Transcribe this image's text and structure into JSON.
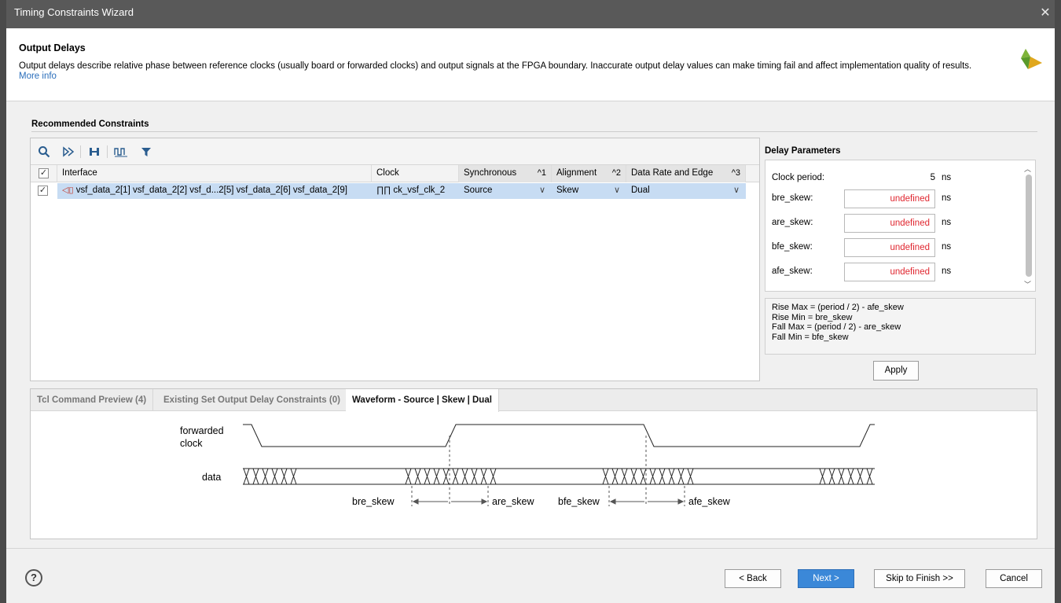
{
  "window": {
    "title": "Timing Constraints Wizard",
    "close_glyph": "✕"
  },
  "header": {
    "title": "Output Delays",
    "description": "Output delays describe relative phase between reference clocks (usually board or forwarded clocks) and output signals at the FPGA boundary. Inaccurate output delay values can make timing fail and affect implementation quality of results.",
    "more_info": "More info",
    "logo_icon": "vivado-logo-icon"
  },
  "recommended": {
    "label": "Recommended Constraints",
    "toolbar_icons": [
      "search-icon",
      "select-icon",
      "expand-icon",
      "clock-icon",
      "filter-icon"
    ],
    "columns": [
      {
        "label": "Interface",
        "sort": ""
      },
      {
        "label": "Clock",
        "sort": ""
      },
      {
        "label": "Synchronous",
        "sort": "^1"
      },
      {
        "label": "Alignment",
        "sort": "^2"
      },
      {
        "label": "Data Rate and Edge",
        "sort": "^3"
      }
    ],
    "rows": [
      {
        "checked": true,
        "interface": "vsf_data_2[1] vsf_data_2[2] vsf_d...2[5] vsf_data_2[6] vsf_data_2[9]",
        "clock": "ck_vsf_clk_2",
        "synchronous": "Source",
        "alignment": "Skew",
        "data_rate": "Dual"
      }
    ]
  },
  "delay_parameters": {
    "label": "Delay Parameters",
    "clock_period": {
      "label": "Clock period:",
      "value": "5",
      "unit": "ns"
    },
    "params": [
      {
        "label": "bre_skew:",
        "value": "undefined",
        "unit": "ns"
      },
      {
        "label": "are_skew:",
        "value": "undefined",
        "unit": "ns"
      },
      {
        "label": "bfe_skew:",
        "value": "undefined",
        "unit": "ns"
      },
      {
        "label": "afe_skew:",
        "value": "undefined",
        "unit": "ns"
      }
    ],
    "formulas": [
      "Rise Max = (period / 2) - afe_skew",
      "Rise Min = bre_skew",
      "Fall Max = (period / 2) - are_skew",
      "Fall Min = bfe_skew"
    ],
    "apply_label": "Apply"
  },
  "tabs": [
    {
      "label": "Tcl Command Preview (4)",
      "active": false
    },
    {
      "label": "Existing Set Output Delay Constraints (0)",
      "active": false
    },
    {
      "label": "Waveform - Source | Skew | Dual",
      "active": true
    }
  ],
  "waveform": {
    "clock_label_line1": "forwarded",
    "clock_label_line2": "clock",
    "data_label": "data",
    "skew_labels": [
      "bre_skew",
      "are_skew",
      "bfe_skew",
      "afe_skew"
    ]
  },
  "footer": {
    "help_glyph": "?",
    "back": "< Back",
    "next": "Next >",
    "skip": "Skip to Finish >>",
    "cancel": "Cancel"
  },
  "colors": {
    "accent": "#3b88d8",
    "selection": "#c7dcf3",
    "error_text": "#e0262f",
    "title_bar": "#595959"
  }
}
